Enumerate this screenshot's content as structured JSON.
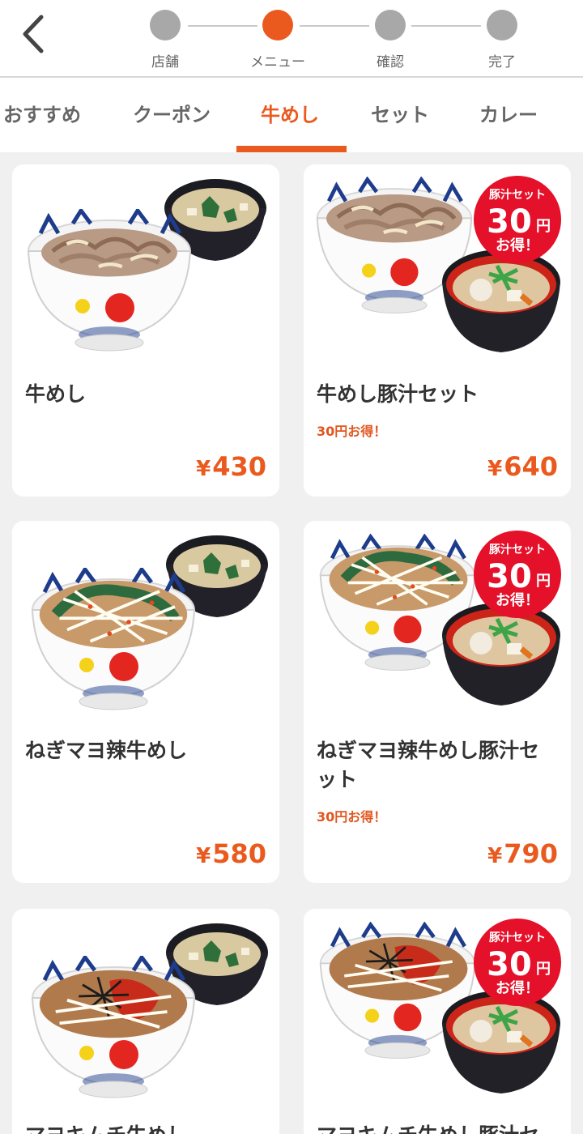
{
  "steps": [
    {
      "label": "店舗",
      "active": false
    },
    {
      "label": "メニュー",
      "active": true
    },
    {
      "label": "確認",
      "active": false
    },
    {
      "label": "完了",
      "active": false
    }
  ],
  "tabs": [
    {
      "label": "おすすめ",
      "active": false
    },
    {
      "label": "クーポン",
      "active": false
    },
    {
      "label": "牛めし",
      "active": true
    },
    {
      "label": "セット",
      "active": false
    },
    {
      "label": "カレー",
      "active": false
    }
  ],
  "badge": {
    "top": "豚汁セット",
    "amount": "30",
    "unit": "円",
    "bottom": "お得！"
  },
  "items": [
    {
      "name": "牛めし",
      "promo": "",
      "yen": "¥",
      "price": "430",
      "image": "gyumeshi-with-miso-soup"
    },
    {
      "name": "牛めし豚汁セット",
      "promo": "30円お得！",
      "yen": "¥",
      "price": "640",
      "image": "gyumeshi-with-tonjiru"
    },
    {
      "name": "ねぎマヨ辣牛めし",
      "promo": "",
      "yen": "¥",
      "price": "580",
      "image": "negi-mayo-gyumeshi-with-miso-soup"
    },
    {
      "name": "ねぎマヨ辣牛めし豚汁セット",
      "promo": "30円お得！",
      "yen": "¥",
      "price": "790",
      "image": "negi-mayo-gyumeshi-with-tonjiru"
    },
    {
      "name": "マヨキムチ牛めし",
      "promo": "",
      "yen": "¥",
      "price": "",
      "image": "mayo-kimchi-gyumeshi-with-miso-soup"
    },
    {
      "name": "マヨキムチ牛めし豚汁セット",
      "promo": "",
      "yen": "¥",
      "price": "",
      "image": "mayo-kimchi-gyumeshi-with-tonjiru"
    }
  ],
  "colors": {
    "accent": "#ea5a1e",
    "inactive": "#a8a8a8",
    "badge": "#e5102a"
  }
}
